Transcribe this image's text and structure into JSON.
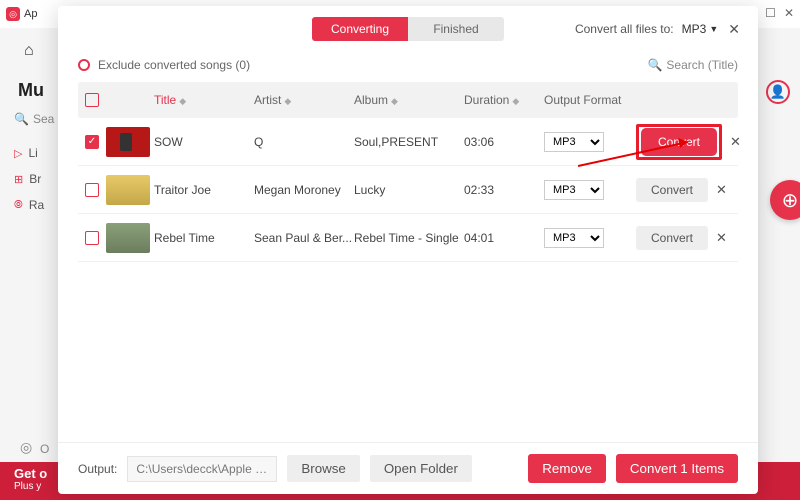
{
  "bg": {
    "title_prefix": "Ap",
    "brand": "Mu",
    "search": "Sea",
    "nav": [
      "Li",
      "Br",
      "Ra"
    ],
    "disc": "O",
    "banner_title": "Get o",
    "banner_sub": "Plus y"
  },
  "header": {
    "tab_active": "Converting",
    "tab_inactive": "Finished",
    "convert_all_label": "Convert all files to:",
    "global_format": "MP3"
  },
  "toolbar": {
    "exclude_label": "Exclude converted songs (0)",
    "search_placeholder": "Search  (Title)"
  },
  "columns": {
    "title": "Title",
    "artist": "Artist",
    "album": "Album",
    "duration": "Duration",
    "output": "Output Format"
  },
  "rows": [
    {
      "checked": true,
      "title": "SOW",
      "artist": "Q",
      "album": "Soul,PRESENT",
      "duration": "03:06",
      "format": "MP3",
      "primary": true,
      "convert_label": "Convert"
    },
    {
      "checked": false,
      "title": "Traitor Joe",
      "artist": "Megan Moroney",
      "album": "Lucky",
      "duration": "02:33",
      "format": "MP3",
      "primary": false,
      "convert_label": "Convert"
    },
    {
      "checked": false,
      "title": "Rebel Time",
      "artist": "Sean Paul & Ber...",
      "album": "Rebel Time - Single",
      "duration": "04:01",
      "format": "MP3",
      "primary": false,
      "convert_label": "Convert"
    }
  ],
  "footer": {
    "output_label": "Output:",
    "output_path": "C:\\Users\\decck\\Apple Music...",
    "browse": "Browse",
    "open_folder": "Open Folder",
    "remove": "Remove",
    "convert_n": "Convert 1 Items"
  }
}
